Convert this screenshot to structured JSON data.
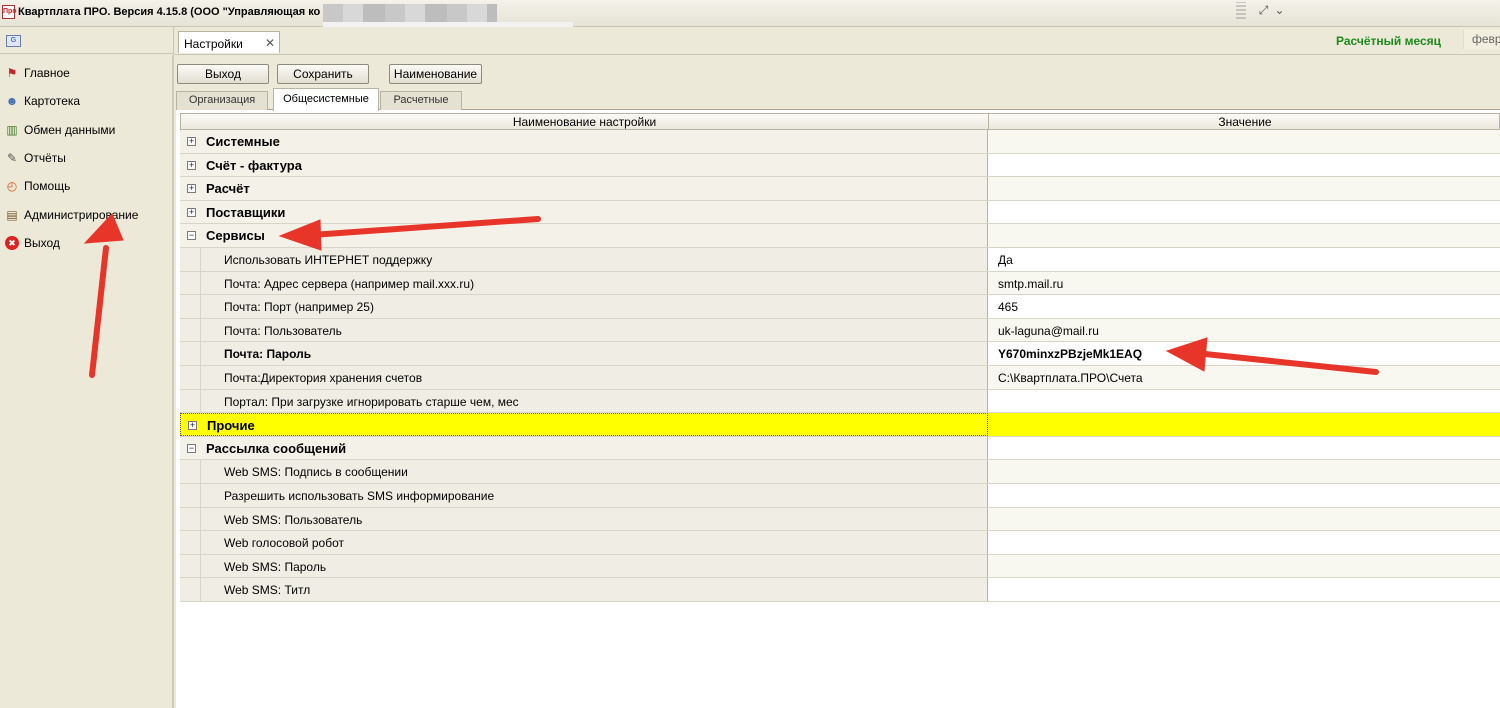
{
  "window": {
    "title": "Квартплата ПРО.  Версия 4.15.8 (ООО \"Управляющая ко",
    "app_icon_text": "Про"
  },
  "sidebar": {
    "items": [
      {
        "label": "Главное",
        "icon": "flag-icon"
      },
      {
        "label": "Картотека",
        "icon": "people-icon"
      },
      {
        "label": "Обмен данными",
        "icon": "exchange-icon"
      },
      {
        "label": "Отчёты",
        "icon": "report-icon"
      },
      {
        "label": "Помощь",
        "icon": "help-icon"
      },
      {
        "label": "Администрирование",
        "icon": "admin-icon"
      },
      {
        "label": "Выход",
        "icon": "exit-icon"
      }
    ]
  },
  "tabs": {
    "doc_tab_label": "Настройки",
    "close": "✕"
  },
  "header": {
    "calc_month_label": "Расчётный месяц",
    "calc_month_value": "февр"
  },
  "toolbar": {
    "exit_label": "Выход",
    "save_label": "Сохранить",
    "name_label": "Наименование"
  },
  "subtabs": [
    {
      "label": "Организация",
      "active": false
    },
    {
      "label": "Общесистемные",
      "active": true
    },
    {
      "label": "Расчетные",
      "active": false
    }
  ],
  "grid": {
    "col_name": "Наименование настройки",
    "col_value": "Значение",
    "rows": [
      {
        "type": "group",
        "expander": "+",
        "name": "Системные",
        "value": ""
      },
      {
        "type": "group",
        "expander": "+",
        "name": "Счёт - фактура",
        "value": ""
      },
      {
        "type": "group",
        "expander": "+",
        "name": "Расчёт",
        "value": ""
      },
      {
        "type": "group",
        "expander": "+",
        "name": "Поставщики",
        "value": ""
      },
      {
        "type": "group",
        "expander": "−",
        "name": "Сервисы",
        "value": ""
      },
      {
        "type": "item",
        "name": "Использовать ИНТЕРНЕТ поддержку",
        "value": "Да"
      },
      {
        "type": "item",
        "name": "Почта: Адрес сервера (например mail.xxx.ru)",
        "value": "smtp.mail.ru"
      },
      {
        "type": "item",
        "name": "Почта: Порт (например 25)",
        "value": "465"
      },
      {
        "type": "item",
        "name": "Почта: Пользователь",
        "value": "uk-laguna@mail.ru"
      },
      {
        "type": "item",
        "name": "Почта: Пароль",
        "value": "Y670minxzPBzjeMk1EAQ",
        "bold": true
      },
      {
        "type": "item",
        "name": "Почта:Директория хранения счетов",
        "value": "C:\\Квартплата.ПРО\\Счета"
      },
      {
        "type": "item",
        "name": "Портал: При загрузке игнорировать старше чем, мес",
        "value": ""
      },
      {
        "type": "group",
        "expander": "+",
        "name": "Прочие",
        "value": "",
        "highlight": true
      },
      {
        "type": "group",
        "expander": "−",
        "name": "Рассылка сообщений",
        "value": ""
      },
      {
        "type": "item",
        "name": "Web SMS: Подпись в сообщении",
        "value": ""
      },
      {
        "type": "item",
        "name": "Разрешить использовать SMS информирование",
        "value": ""
      },
      {
        "type": "item",
        "name": "Web SMS: Пользователь",
        "value": ""
      },
      {
        "type": "item",
        "name": "Web голосовой робот",
        "value": ""
      },
      {
        "type": "item",
        "name": "Web SMS: Пароль",
        "value": ""
      },
      {
        "type": "item",
        "name": "Web SMS: Титл",
        "value": ""
      }
    ]
  },
  "colors": {
    "calc_month": "#1c8a1c",
    "highlight_row": "#ffff00",
    "annotation_arrow": "#e8352a"
  }
}
